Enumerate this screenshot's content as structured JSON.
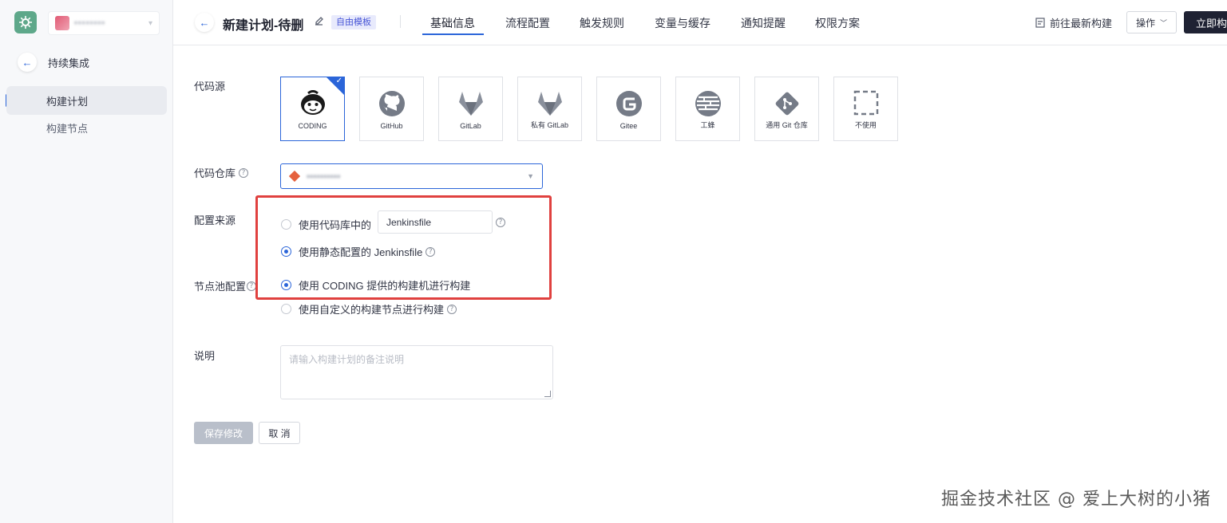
{
  "sidebar": {
    "project_name": "▪▪▪▪▪▪▪▪",
    "back_label": "持续集成",
    "items": [
      {
        "label": "构建计划",
        "active": true
      },
      {
        "label": "构建节点",
        "active": false
      }
    ]
  },
  "header": {
    "title": "新建计划-待删",
    "tag": "自由模板",
    "tabs": [
      "基础信息",
      "流程配置",
      "触发规则",
      "变量与缓存",
      "通知提醒",
      "权限方案"
    ],
    "active_tab": "基础信息",
    "goto_latest": "前往最新构建",
    "ops_label": "操作",
    "run_label": "立即构建"
  },
  "form": {
    "source_label": "代码源",
    "sources": [
      {
        "name": "CODING",
        "icon": "coding-monkey-icon",
        "selected": true
      },
      {
        "name": "GitHub",
        "icon": "github-icon",
        "selected": false
      },
      {
        "name": "GitLab",
        "icon": "gitlab-icon",
        "selected": false
      },
      {
        "name": "私有 GitLab",
        "icon": "private-gitlab-icon",
        "selected": false
      },
      {
        "name": "Gitee",
        "icon": "gitee-icon",
        "selected": false
      },
      {
        "name": "工蜂",
        "icon": "gongfeng-icon",
        "selected": false
      },
      {
        "name": "通用 Git 仓库",
        "icon": "git-icon",
        "selected": false
      },
      {
        "name": "不使用",
        "icon": "dashed-square-icon",
        "selected": false
      }
    ],
    "repo_label": "代码仓库",
    "repo_value": "▪▪▪▪▪▪▪▪▪▪",
    "config_label": "配置来源",
    "config_option_repo": "使用代码库中的",
    "jenkinsfile_path": "Jenkinsfile",
    "config_option_static": "使用静态配置的 Jenkinsfile",
    "node_label": "节点池配置",
    "node_option_coding": "使用 CODING 提供的构建机进行构建",
    "node_option_custom": "使用自定义的构建节点进行构建",
    "desc_label": "说明",
    "desc_placeholder": "请输入构建计划的备注说明",
    "save_label": "保存修改",
    "cancel_label": "取 消"
  },
  "watermark": "掘金技术社区 @ 爱上大树的小猪",
  "colors": {
    "accent": "#2b65d9",
    "highlight_box": "#e0413f",
    "dark_button": "#1f2233"
  }
}
